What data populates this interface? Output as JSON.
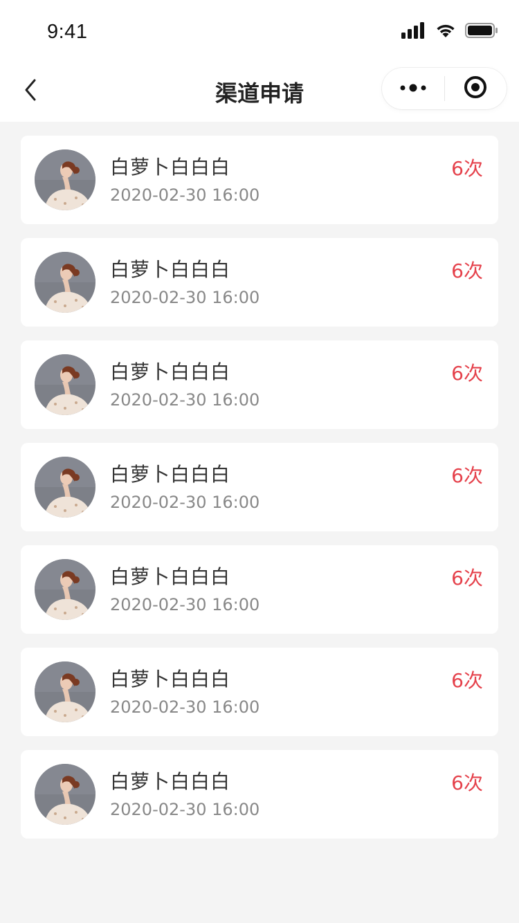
{
  "status_bar": {
    "time": "9:41",
    "icons": [
      "signal-icon",
      "wifi-icon",
      "battery-icon"
    ]
  },
  "nav": {
    "title": "渠道申请",
    "back_icon": "chevron-left-icon",
    "more_icon": "more-dots-icon",
    "close_icon": "target-circle-icon"
  },
  "colors": {
    "accent": "#e5414b",
    "background": "#f4f4f4",
    "card": "#ffffff"
  },
  "records": [
    {
      "name": "白萝卜白白白",
      "date": "2020-02-30 16:00",
      "count": "6次"
    },
    {
      "name": "白萝卜白白白",
      "date": "2020-02-30 16:00",
      "count": "6次"
    },
    {
      "name": "白萝卜白白白",
      "date": "2020-02-30 16:00",
      "count": "6次"
    },
    {
      "name": "白萝卜白白白",
      "date": "2020-02-30 16:00",
      "count": "6次"
    },
    {
      "name": "白萝卜白白白",
      "date": "2020-02-30 16:00",
      "count": "6次"
    },
    {
      "name": "白萝卜白白白",
      "date": "2020-02-30 16:00",
      "count": "6次"
    },
    {
      "name": "白萝卜白白白",
      "date": "2020-02-30 16:00",
      "count": "6次"
    }
  ]
}
